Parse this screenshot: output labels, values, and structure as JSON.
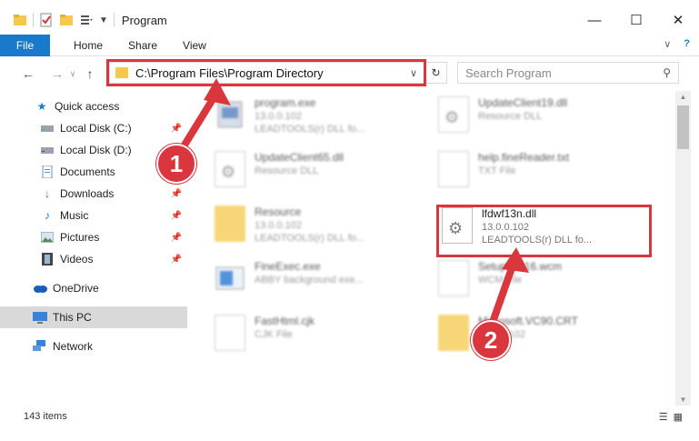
{
  "window": {
    "title": "Program"
  },
  "ribbon": {
    "tabs": [
      {
        "label": "File"
      },
      {
        "label": "Home"
      },
      {
        "label": "Share"
      },
      {
        "label": "View"
      }
    ]
  },
  "address": {
    "path": "C:\\Program Files\\Program Directory"
  },
  "search": {
    "placeholder": "Search Program"
  },
  "sidebar": {
    "items": [
      {
        "label": "Quick access",
        "icon": "star-icon"
      },
      {
        "label": "Local Disk (C:)",
        "icon": "drive-icon",
        "pinned": true
      },
      {
        "label": "Local Disk (D:)",
        "icon": "drive-icon"
      },
      {
        "label": "Documents",
        "icon": "documents-icon",
        "pinned": true
      },
      {
        "label": "Downloads",
        "icon": "download-icon",
        "pinned": true
      },
      {
        "label": "Music",
        "icon": "music-icon",
        "pinned": true
      },
      {
        "label": "Pictures",
        "icon": "pictures-icon",
        "pinned": true
      },
      {
        "label": "Videos",
        "icon": "videos-icon",
        "pinned": true
      },
      {
        "label": "OneDrive",
        "icon": "cloud-icon"
      },
      {
        "label": "This PC",
        "icon": "computer-icon",
        "selected": true
      },
      {
        "label": "Network",
        "icon": "network-icon"
      }
    ]
  },
  "files": [
    {
      "name": "program.exe",
      "line1": "13.0.0.102",
      "line2": "LEADTOOLS(r) DLL fo...",
      "kind": "exe"
    },
    {
      "name": "UpdateClient19.dll",
      "line1": "Resource DLL",
      "line2": "",
      "kind": "dll"
    },
    {
      "name": "UpdateClient65.dll",
      "line1": "Resource DLL",
      "line2": "",
      "kind": "dll"
    },
    {
      "name": "help.fineReader.txt",
      "line1": "TXT File",
      "line2": "",
      "kind": "txt"
    },
    {
      "name": "Resource",
      "line1": "13.0.0.102",
      "line2": "LEADTOOLS(r) DLL fo...",
      "kind": "folder"
    },
    {
      "name": "lfdwf13n.dll",
      "line1": "13.0.0.102",
      "line2": "LEADTOOLS(r) DLL fo...",
      "kind": "dll",
      "highlighted": true
    },
    {
      "name": "FineExec.exe",
      "line1": "ABBY background exe...",
      "line2": "",
      "kind": "app"
    },
    {
      "name": "SetupWP16.wcm",
      "line1": "WCM File",
      "line2": "",
      "kind": "txt"
    },
    {
      "name": "FastHtml.cjk",
      "line1": "CJK File",
      "line2": "",
      "kind": "txt"
    },
    {
      "name": "Microsoft.VC90.CRT",
      "line1": "13.0.0.102",
      "line2": "",
      "kind": "folder"
    }
  ],
  "status": {
    "count": "143 items"
  },
  "callouts": [
    {
      "label": "1"
    },
    {
      "label": "2"
    }
  ],
  "colors": {
    "accent": "#1979ca",
    "highlight": "#d9363e",
    "folder": "#f5c94b"
  }
}
